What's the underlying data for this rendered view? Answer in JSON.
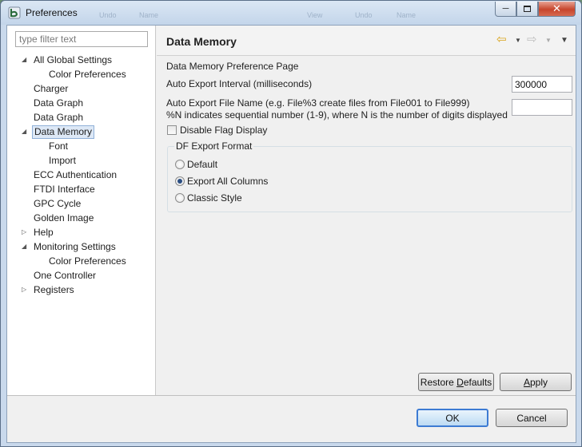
{
  "window": {
    "title": "Preferences",
    "ghost_labels": [
      "Undo",
      "Name",
      "View",
      "Undo",
      "Name"
    ]
  },
  "filter": {
    "placeholder": "type filter text",
    "value": ""
  },
  "tree": [
    {
      "label": "All Global Settings",
      "level": 0,
      "expander": "expanded"
    },
    {
      "label": "Color Preferences",
      "level": 1
    },
    {
      "label": "Charger",
      "level": 0
    },
    {
      "label": "Data Graph",
      "level": 0
    },
    {
      "label": "Data Graph",
      "level": 0
    },
    {
      "label": "Data Memory",
      "level": 0,
      "expander": "expanded",
      "selected": true
    },
    {
      "label": "Font",
      "level": 1
    },
    {
      "label": "Import",
      "level": 1
    },
    {
      "label": "ECC Authentication",
      "level": 0
    },
    {
      "label": "FTDI Interface",
      "level": 0
    },
    {
      "label": "GPC Cycle",
      "level": 0
    },
    {
      "label": "Golden Image",
      "level": 0
    },
    {
      "label": "Help",
      "level": 0,
      "expander": "collapsed"
    },
    {
      "label": "Monitoring Settings",
      "level": 0,
      "expander": "expanded"
    },
    {
      "label": "Color Preferences",
      "level": 1
    },
    {
      "label": "One Controller",
      "level": 0
    },
    {
      "label": "Registers",
      "level": 0,
      "expander": "collapsed"
    }
  ],
  "page": {
    "title": "Data Memory",
    "description": "Data Memory Preference Page",
    "auto_export_interval": {
      "label": "Auto Export Interval (milliseconds)",
      "value": "300000"
    },
    "auto_export_file": {
      "label_line1": "Auto Export File Name (e.g. File%3 create files from File001 to File999)",
      "label_line2": "%N indicates sequential number (1-9), where N is the number of digits displayed",
      "value": ""
    },
    "disable_flag": {
      "label": "Disable Flag Display",
      "checked": false
    },
    "export_format": {
      "title": "DF Export Format",
      "options": [
        {
          "label": "Default",
          "checked": false
        },
        {
          "label": "Export All Columns",
          "checked": true
        },
        {
          "label": "Classic Style",
          "checked": false
        }
      ]
    },
    "restore_defaults_pre": "Restore ",
    "restore_defaults_mnemonic": "D",
    "restore_defaults_post": "efaults",
    "apply_mnemonic": "A",
    "apply_post": "pply"
  },
  "footer": {
    "ok_label": "OK",
    "cancel_label": "Cancel"
  },
  "colors": {
    "selection_bg": "#dde8f6",
    "default_button_border": "#3d7bd3",
    "close_button": "#c7452c"
  }
}
